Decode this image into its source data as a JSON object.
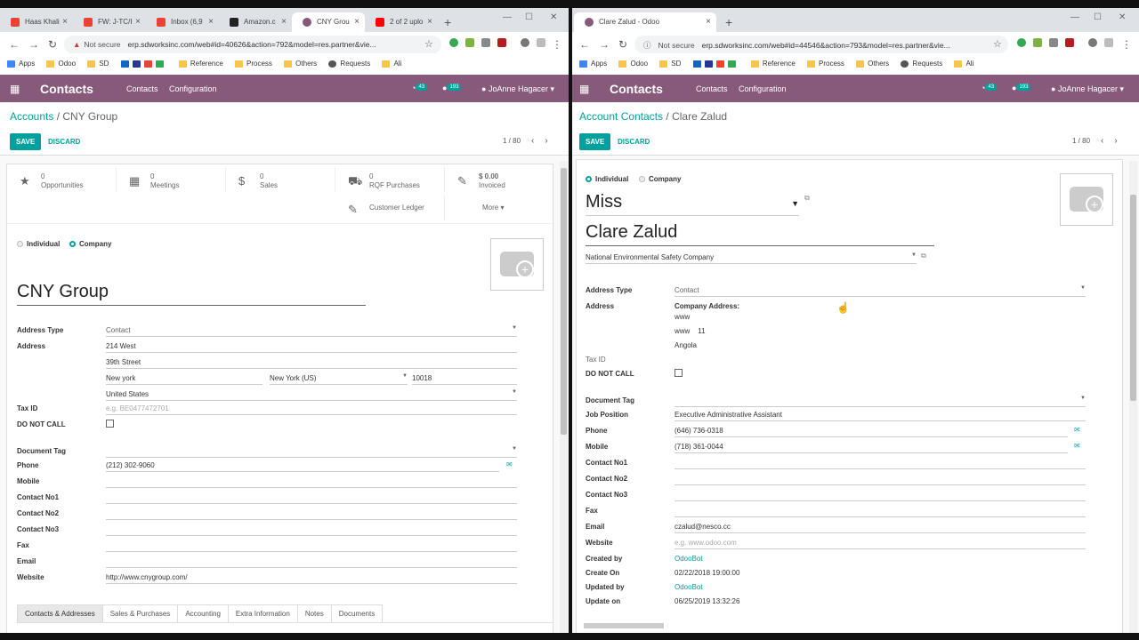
{
  "left": {
    "tabs": [
      {
        "label": "Haas Khali",
        "color": "#ea4335"
      },
      {
        "label": "FW: J-TC/I",
        "color": "#ea4335"
      },
      {
        "label": "Inbox (6,9",
        "color": "#ea4335"
      },
      {
        "label": "Amazon.c",
        "color": "#222222"
      },
      {
        "label": "CNY Grou",
        "color": "#875a7b"
      },
      {
        "label": "2 of 2 uplo",
        "color": "#ff0000"
      }
    ],
    "url_security": "Not secure",
    "url": "erp.sdworksinc.com/web#id=40626&action=792&model=res.partner&vie...",
    "bookmarks": [
      "Apps",
      "Odoo",
      "SD",
      "",
      "Reference",
      "Process",
      "Others",
      "Requests",
      "Ali"
    ],
    "app_title": "Contacts",
    "menu": [
      "Contacts",
      "Configuration"
    ],
    "activity_count": "43",
    "message_count": "193",
    "user": "JoAnne Hagacer",
    "breadcrumb_parent": "Accounts",
    "breadcrumb_current": "CNY Group",
    "save": "SAVE",
    "discard": "DISCARD",
    "pager": "1 / 80",
    "smart_buttons": [
      {
        "icon": "★",
        "name": "star-icon",
        "l1": "0",
        "l2": "Opportunities"
      },
      {
        "icon": "▦",
        "name": "calendar-icon",
        "l1": "0",
        "l2": "Meetings"
      },
      {
        "icon": "$",
        "name": "dollar-icon",
        "l1": "0",
        "l2": "Sales"
      },
      {
        "icon": "🛒",
        "name": "cart-icon",
        "l1": "0",
        "l2": "RQF Purchases"
      },
      {
        "icon": "✎",
        "name": "edit-icon",
        "l1": "$ 0.00",
        "l2": "Invoiced"
      },
      {
        "icon": "✎",
        "name": "ledger-icon",
        "l1": "",
        "l2": "Customer Ledger"
      }
    ],
    "more": "More",
    "individual": "Individual",
    "company": "Company",
    "name": "CNY Group",
    "labels": {
      "address_type": "Address Type",
      "address": "Address",
      "tax_id": "Tax ID",
      "do_not_call": "DO NOT CALL",
      "document_tag": "Document Tag",
      "phone": "Phone",
      "mobile": "Mobile",
      "contact_no1": "Contact No1",
      "contact_no2": "Contact No2",
      "contact_no3": "Contact No3",
      "fax": "Fax",
      "email": "Email",
      "website": "Website"
    },
    "values": {
      "address_type": "Contact",
      "street1": "214 West",
      "street2": "39th Street",
      "city": "New york",
      "state": "New York (US)",
      "zip": "10018",
      "country": "United States",
      "tax_placeholder": "e.g. BE0477472701",
      "phone": "(212) 302-9060",
      "website": "http://www.cnygroup.com/"
    },
    "notebook": [
      "Contacts & Addresses",
      "Sales & Purchases",
      "Accounting",
      "Extra Information",
      "Notes",
      "Documents"
    ]
  },
  "right": {
    "tab": "Clare Zalud - Odoo",
    "url_security": "Not secure",
    "url": "erp.sdworksinc.com/web#id=44546&action=793&model=res.partner&vie...",
    "bookmarks": [
      "Apps",
      "Odoo",
      "SD",
      "",
      "Reference",
      "Process",
      "Others",
      "Requests",
      "Ali"
    ],
    "app_title": "Contacts",
    "menu": [
      "Contacts",
      "Configuration"
    ],
    "activity_count": "43",
    "message_count": "193",
    "user": "JoAnne Hagacer",
    "breadcrumb_parent": "Account Contacts",
    "breadcrumb_current": "Clare Zalud",
    "save": "SAVE",
    "discard": "DISCARD",
    "pager": "1 / 80",
    "individual": "Individual",
    "company": "Company",
    "title": "Miss",
    "name": "Clare Zalud",
    "parent_company": "National Environmental Safety Company",
    "labels": {
      "address_type": "Address Type",
      "address": "Address",
      "tax_id": "Tax ID",
      "do_not_call": "DO NOT CALL",
      "document_tag": "Document Tag",
      "job_position": "Job Position",
      "phone": "Phone",
      "mobile": "Mobile",
      "contact_no1": "Contact No1",
      "contact_no2": "Contact No2",
      "contact_no3": "Contact No3",
      "fax": "Fax",
      "email": "Email",
      "website": "Website",
      "created_by": "Created by",
      "create_on": "Create On",
      "updated_by": "Updated by",
      "update_on": "Update on"
    },
    "values": {
      "address_type": "Contact",
      "company_address": "Company Address:",
      "addr1": "www",
      "addr2": "www    11",
      "addr3": "Angola",
      "job_position": "Executive Administrative Assistant",
      "phone": "(646) 736-0318",
      "mobile": "(718) 361-0044",
      "email": "czalud@nesco.cc",
      "website_placeholder": "e.g. www.odoo.com",
      "created_by": "OdooBot",
      "create_on": "02/22/2018 19:00:00",
      "updated_by": "OdooBot",
      "update_on": "06/25/2019 13:32:26"
    }
  },
  "colors": {
    "odoo_purple": "#875a7b",
    "teal": "#00a09d"
  }
}
